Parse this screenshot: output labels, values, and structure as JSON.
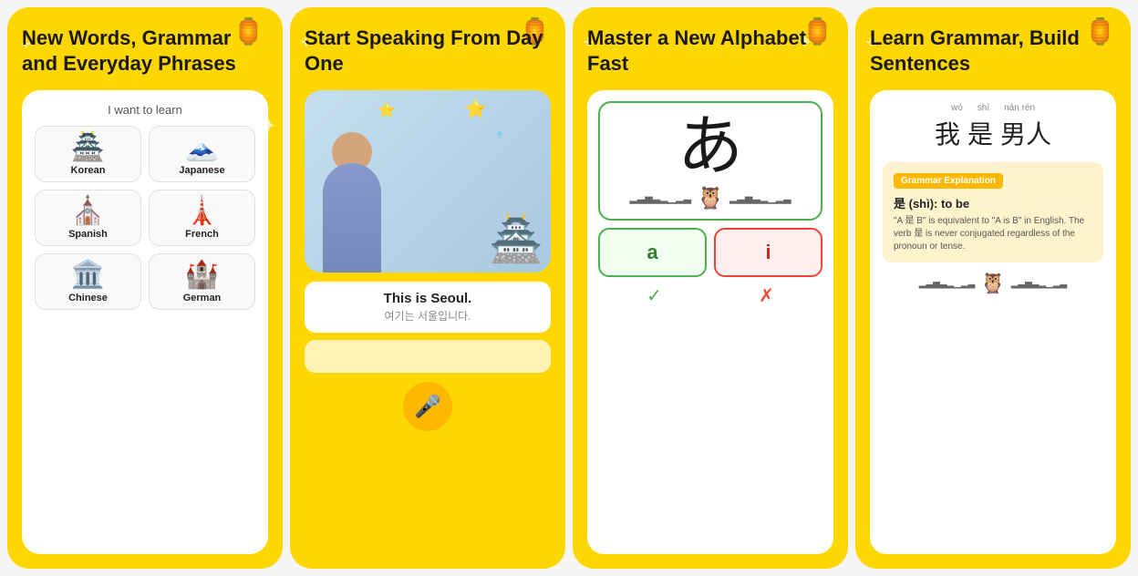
{
  "panel1": {
    "title": "New Words, Grammar and Everyday Phrases",
    "subtitle": "I want to learn",
    "languages": [
      {
        "name": "Korean",
        "icon": "🏯",
        "row": 0
      },
      {
        "name": "Japanese",
        "icon": "🗻",
        "row": 0
      },
      {
        "name": "Spanish",
        "icon": "⛪",
        "row": 1
      },
      {
        "name": "French",
        "icon": "🗼",
        "row": 1
      },
      {
        "name": "Chinese",
        "icon": "🏛️",
        "row": 2
      },
      {
        "name": "German",
        "icon": "🏰",
        "row": 2
      }
    ]
  },
  "panel2": {
    "title": "Start Speaking From Day One",
    "speech_main": "This is Seoul.",
    "speech_sub": "여기는 서울입니다.",
    "mic_aria": "microphone"
  },
  "panel3": {
    "title": "Master a New Alphabet Fast",
    "character": "あ",
    "answers": [
      {
        "label": "a",
        "type": "correct"
      },
      {
        "label": "i",
        "type": "wrong"
      }
    ]
  },
  "panel4": {
    "title": "Learn Grammar, Build Sentences",
    "pinyin": [
      "wó",
      "shì",
      "nán rén"
    ],
    "characters": [
      "我",
      "是",
      "男人"
    ],
    "grammar_box_title": "Grammar Explanation",
    "grammar_main": "是 (shì): to be",
    "grammar_desc": "\"A 是 B\" is equivalent to \"A is B\" in English. The verb 是 is never conjugated regardless of the pronoun or tense."
  }
}
